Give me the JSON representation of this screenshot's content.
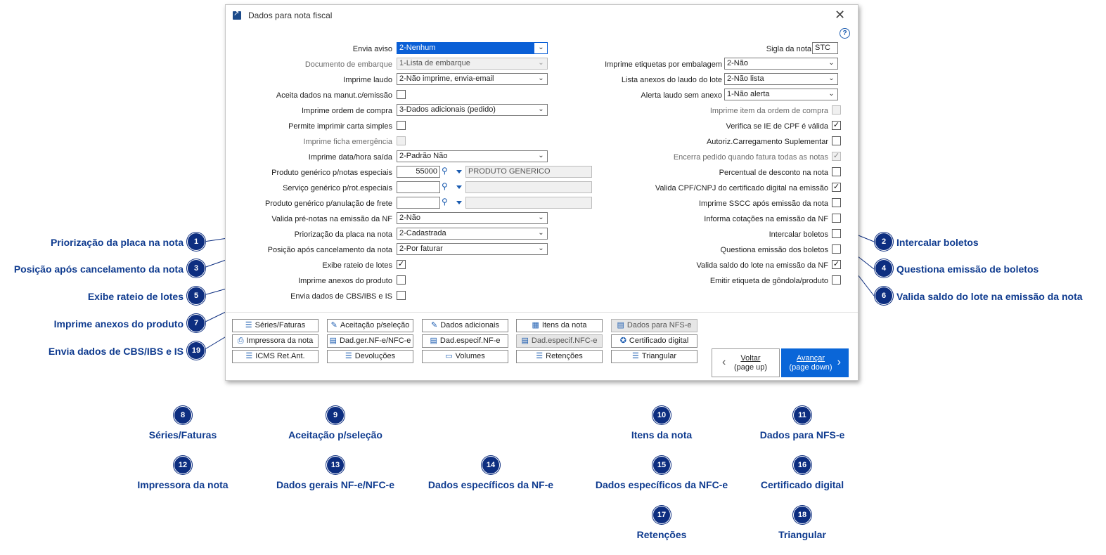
{
  "window": {
    "title": "Dados para nota fiscal",
    "close": "✕",
    "help": "?"
  },
  "left": {
    "envia_aviso": {
      "label": "Envia aviso",
      "value": "2-Nenhum"
    },
    "documento_embarque": {
      "label": "Documento de embarque",
      "value": "1-Lista de embarque"
    },
    "imprime_laudo": {
      "label": "Imprime laudo",
      "value": "2-Não imprime, envia-email"
    },
    "aceita_dados": {
      "label": "Aceita dados na manut.c/emissão"
    },
    "imprime_ordem": {
      "label": "Imprime ordem de compra",
      "value": "3-Dados adicionais (pedido)"
    },
    "permite_carta": {
      "label": "Permite imprimir carta simples"
    },
    "imprime_ficha": {
      "label": "Imprime ficha emergência"
    },
    "imprime_data": {
      "label": "Imprime data/hora saída",
      "value": "2-Padrão Não"
    },
    "produto_generico": {
      "label": "Produto genérico p/notas especiais",
      "code": "55000",
      "desc": "PRODUTO GENERICO"
    },
    "servico_generico": {
      "label": "Serviço genérico p/rot.especiais"
    },
    "produto_anulacao": {
      "label": "Produto genérico p/anulação de frete"
    },
    "valida_pre_notas": {
      "label": "Valida pré-notas na emissão da NF",
      "value": "2-Não"
    },
    "priorizacao_placa": {
      "label": "Priorização da placa na nota",
      "value": "2-Cadastrada"
    },
    "posicao_cancelamento": {
      "label": "Posição após cancelamento da nota",
      "value": "2-Por faturar"
    },
    "exibe_rateio": {
      "label": "Exibe rateio de lotes"
    },
    "imprime_anexos": {
      "label": "Imprime anexos do produto"
    },
    "envia_cbs": {
      "label": "Envia dados de CBS/IBS e IS"
    }
  },
  "right": {
    "sigla_nota": {
      "label": "Sigla da nota",
      "value": "STC"
    },
    "imprime_etiquetas": {
      "label": "Imprime etiquetas por embalagem",
      "value": "2-Não"
    },
    "lista_anexos": {
      "label": "Lista anexos do laudo do lote",
      "value": "2-Não lista"
    },
    "alerta_laudo": {
      "label": "Alerta laudo sem anexo",
      "value": "1-Não alerta"
    },
    "imprime_item_ordem": {
      "label": "Imprime item da ordem de compra"
    },
    "verifica_ie": {
      "label": "Verifica se IE de CPF é válida"
    },
    "autoriz_carregamento": {
      "label": "Autoriz.Carregamento Suplementar"
    },
    "encerra_pedido": {
      "label": "Encerra pedido quando fatura todas as notas"
    },
    "percentual_desconto": {
      "label": "Percentual de desconto na nota"
    },
    "valida_cpf": {
      "label": "Valida CPF/CNPJ do certificado digital na emissão"
    },
    "imprime_sscc": {
      "label": "Imprime SSCC após emissão da nota"
    },
    "informa_cotacoes": {
      "label": "Informa cotações na emissão da NF"
    },
    "intercalar_boletos": {
      "label": "Intercalar boletos"
    },
    "questiona_emissao": {
      "label": "Questiona emissão dos boletos"
    },
    "valida_saldo": {
      "label": "Valida saldo do lote na emissão da NF"
    },
    "emitir_etiqueta": {
      "label": "Emitir etiqueta de gôndola/produto"
    }
  },
  "check_mark": "✓",
  "arrow_glyph": "⌄",
  "buttons": {
    "series": "Séries/Faturas",
    "aceitacao": "Aceitação p/seleção",
    "dados_adicionais": "Dados adicionais",
    "itens": "Itens da nota",
    "dados_nfse": "Dados para NFS-e",
    "impressora": "Impressora da nota",
    "dad_ger": "Dad.ger.NF-e/NFC-e",
    "dad_espec_nfe": "Dad.especif.NF-e",
    "dad_espec_nfce": "Dad.especif.NFC-e",
    "certificado": "Certificado digital",
    "icms": "ICMS Ret.Ant.",
    "devolucoes": "Devoluções",
    "volumes": "Volumes",
    "retencoes": "Retenções",
    "triangular": "Triangular",
    "voltar_1": "Voltar",
    "voltar_2": "(page up)",
    "avancar_1": "Avançar",
    "avancar_2": "(page down)"
  },
  "callouts": {
    "c1": {
      "num": "1",
      "text": "Priorização da placa na nota"
    },
    "c2": {
      "num": "2",
      "text": "Intercalar boletos"
    },
    "c3": {
      "num": "3",
      "text": "Posição após cancelamento da nota"
    },
    "c4": {
      "num": "4",
      "text": "Questiona emissão de boletos"
    },
    "c5": {
      "num": "5",
      "text": "Exibe rateio de lotes"
    },
    "c6": {
      "num": "6",
      "text": "Valida saldo do lote na emissão da nota"
    },
    "c7": {
      "num": "7",
      "text": "Imprime anexos do produto"
    },
    "c19": {
      "num": "19",
      "text": "Envia dados de CBS/IBS e IS"
    },
    "c8": {
      "num": "8",
      "text": "Séries/Faturas"
    },
    "c9": {
      "num": "9",
      "text": "Aceitação p/seleção"
    },
    "c10": {
      "num": "10",
      "text": "Itens da nota"
    },
    "c11": {
      "num": "11",
      "text": "Dados para NFS-e"
    },
    "c12": {
      "num": "12",
      "text": "Impressora da nota"
    },
    "c13": {
      "num": "13",
      "text": "Dados gerais NF-e/NFC-e"
    },
    "c14": {
      "num": "14",
      "text": "Dados específicos da NF-e"
    },
    "c15": {
      "num": "15",
      "text": "Dados específicos da NFC-e"
    },
    "c16": {
      "num": "16",
      "text": "Certificado digital"
    },
    "c17": {
      "num": "17",
      "text": "Retenções"
    },
    "c18": {
      "num": "18",
      "text": "Triangular"
    }
  }
}
